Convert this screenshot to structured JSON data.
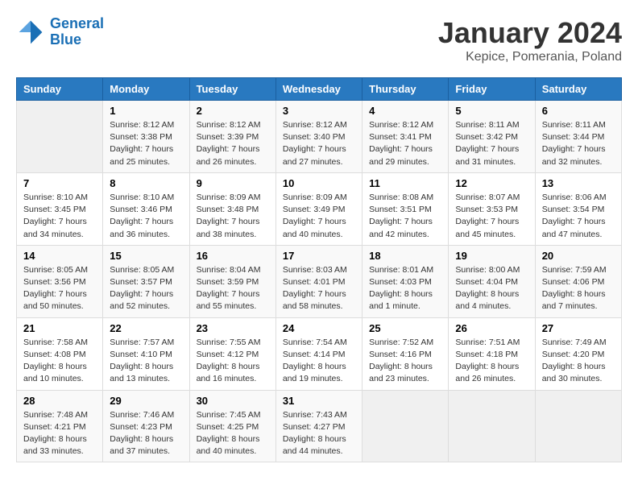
{
  "logo": {
    "line1": "General",
    "line2": "Blue"
  },
  "title": "January 2024",
  "location": "Kepice, Pomerania, Poland",
  "days_of_week": [
    "Sunday",
    "Monday",
    "Tuesday",
    "Wednesday",
    "Thursday",
    "Friday",
    "Saturday"
  ],
  "weeks": [
    [
      {
        "day": "",
        "info": ""
      },
      {
        "day": "1",
        "info": "Sunrise: 8:12 AM\nSunset: 3:38 PM\nDaylight: 7 hours\nand 25 minutes."
      },
      {
        "day": "2",
        "info": "Sunrise: 8:12 AM\nSunset: 3:39 PM\nDaylight: 7 hours\nand 26 minutes."
      },
      {
        "day": "3",
        "info": "Sunrise: 8:12 AM\nSunset: 3:40 PM\nDaylight: 7 hours\nand 27 minutes."
      },
      {
        "day": "4",
        "info": "Sunrise: 8:12 AM\nSunset: 3:41 PM\nDaylight: 7 hours\nand 29 minutes."
      },
      {
        "day": "5",
        "info": "Sunrise: 8:11 AM\nSunset: 3:42 PM\nDaylight: 7 hours\nand 31 minutes."
      },
      {
        "day": "6",
        "info": "Sunrise: 8:11 AM\nSunset: 3:44 PM\nDaylight: 7 hours\nand 32 minutes."
      }
    ],
    [
      {
        "day": "7",
        "info": "Sunrise: 8:10 AM\nSunset: 3:45 PM\nDaylight: 7 hours\nand 34 minutes."
      },
      {
        "day": "8",
        "info": "Sunrise: 8:10 AM\nSunset: 3:46 PM\nDaylight: 7 hours\nand 36 minutes."
      },
      {
        "day": "9",
        "info": "Sunrise: 8:09 AM\nSunset: 3:48 PM\nDaylight: 7 hours\nand 38 minutes."
      },
      {
        "day": "10",
        "info": "Sunrise: 8:09 AM\nSunset: 3:49 PM\nDaylight: 7 hours\nand 40 minutes."
      },
      {
        "day": "11",
        "info": "Sunrise: 8:08 AM\nSunset: 3:51 PM\nDaylight: 7 hours\nand 42 minutes."
      },
      {
        "day": "12",
        "info": "Sunrise: 8:07 AM\nSunset: 3:53 PM\nDaylight: 7 hours\nand 45 minutes."
      },
      {
        "day": "13",
        "info": "Sunrise: 8:06 AM\nSunset: 3:54 PM\nDaylight: 7 hours\nand 47 minutes."
      }
    ],
    [
      {
        "day": "14",
        "info": "Sunrise: 8:05 AM\nSunset: 3:56 PM\nDaylight: 7 hours\nand 50 minutes."
      },
      {
        "day": "15",
        "info": "Sunrise: 8:05 AM\nSunset: 3:57 PM\nDaylight: 7 hours\nand 52 minutes."
      },
      {
        "day": "16",
        "info": "Sunrise: 8:04 AM\nSunset: 3:59 PM\nDaylight: 7 hours\nand 55 minutes."
      },
      {
        "day": "17",
        "info": "Sunrise: 8:03 AM\nSunset: 4:01 PM\nDaylight: 7 hours\nand 58 minutes."
      },
      {
        "day": "18",
        "info": "Sunrise: 8:01 AM\nSunset: 4:03 PM\nDaylight: 8 hours\nand 1 minute."
      },
      {
        "day": "19",
        "info": "Sunrise: 8:00 AM\nSunset: 4:04 PM\nDaylight: 8 hours\nand 4 minutes."
      },
      {
        "day": "20",
        "info": "Sunrise: 7:59 AM\nSunset: 4:06 PM\nDaylight: 8 hours\nand 7 minutes."
      }
    ],
    [
      {
        "day": "21",
        "info": "Sunrise: 7:58 AM\nSunset: 4:08 PM\nDaylight: 8 hours\nand 10 minutes."
      },
      {
        "day": "22",
        "info": "Sunrise: 7:57 AM\nSunset: 4:10 PM\nDaylight: 8 hours\nand 13 minutes."
      },
      {
        "day": "23",
        "info": "Sunrise: 7:55 AM\nSunset: 4:12 PM\nDaylight: 8 hours\nand 16 minutes."
      },
      {
        "day": "24",
        "info": "Sunrise: 7:54 AM\nSunset: 4:14 PM\nDaylight: 8 hours\nand 19 minutes."
      },
      {
        "day": "25",
        "info": "Sunrise: 7:52 AM\nSunset: 4:16 PM\nDaylight: 8 hours\nand 23 minutes."
      },
      {
        "day": "26",
        "info": "Sunrise: 7:51 AM\nSunset: 4:18 PM\nDaylight: 8 hours\nand 26 minutes."
      },
      {
        "day": "27",
        "info": "Sunrise: 7:49 AM\nSunset: 4:20 PM\nDaylight: 8 hours\nand 30 minutes."
      }
    ],
    [
      {
        "day": "28",
        "info": "Sunrise: 7:48 AM\nSunset: 4:21 PM\nDaylight: 8 hours\nand 33 minutes."
      },
      {
        "day": "29",
        "info": "Sunrise: 7:46 AM\nSunset: 4:23 PM\nDaylight: 8 hours\nand 37 minutes."
      },
      {
        "day": "30",
        "info": "Sunrise: 7:45 AM\nSunset: 4:25 PM\nDaylight: 8 hours\nand 40 minutes."
      },
      {
        "day": "31",
        "info": "Sunrise: 7:43 AM\nSunset: 4:27 PM\nDaylight: 8 hours\nand 44 minutes."
      },
      {
        "day": "",
        "info": ""
      },
      {
        "day": "",
        "info": ""
      },
      {
        "day": "",
        "info": ""
      }
    ]
  ]
}
